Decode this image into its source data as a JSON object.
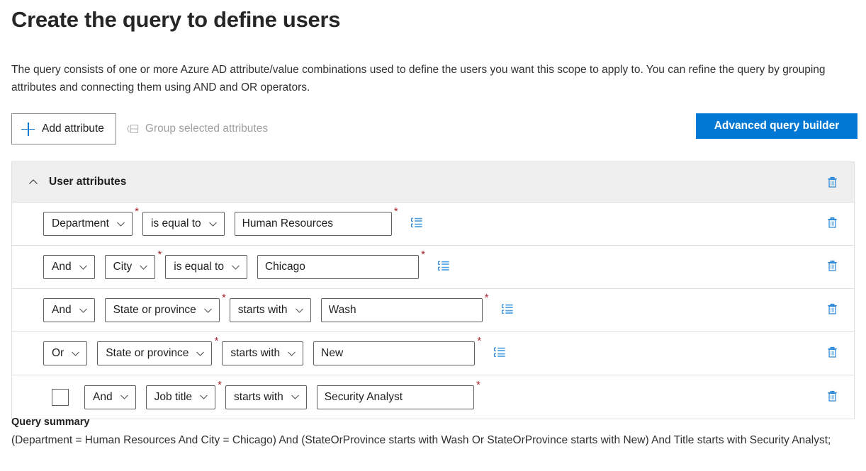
{
  "header": {
    "title": "Create the query to define users",
    "description": "The query consists of one or more Azure AD attribute/value combinations used to define the users you want this scope to apply to. You can refine the query by grouping attributes and connecting them using AND and OR operators."
  },
  "toolbar": {
    "add_attribute_label": "Add attribute",
    "group_selected_label": "Group selected attributes",
    "advanced_query_builder_label": "Advanced query builder",
    "add_icon": "plus-icon",
    "group_icon": "group-attributes-icon"
  },
  "group": {
    "title": "User attributes",
    "collapse_icon": "chevron-up-icon",
    "delete_icon": "trash-icon"
  },
  "rows": [
    {
      "has_checkbox": false,
      "checkbox_checked": false,
      "connector": null,
      "attribute": "Department",
      "operator": "is equal to",
      "value": "Human Resources",
      "value_width": 222,
      "has_list_icon": true,
      "attribute_required": true,
      "value_required": true
    },
    {
      "has_checkbox": false,
      "checkbox_checked": false,
      "connector": "And",
      "attribute": "City",
      "operator": "is equal to",
      "value": "Chicago",
      "value_width": 228,
      "has_list_icon": true,
      "attribute_required": true,
      "value_required": true
    },
    {
      "has_checkbox": false,
      "checkbox_checked": false,
      "connector": "And",
      "attribute": "State or province",
      "operator": "starts with",
      "value": "Wash",
      "value_width": 228,
      "has_list_icon": true,
      "attribute_required": true,
      "value_required": true
    },
    {
      "has_checkbox": false,
      "checkbox_checked": false,
      "connector": "Or",
      "attribute": "State or province",
      "operator": "starts with",
      "value": "New",
      "value_width": 228,
      "has_list_icon": true,
      "attribute_required": true,
      "value_required": true
    },
    {
      "has_checkbox": true,
      "checkbox_checked": false,
      "connector": "And",
      "attribute": "Job title",
      "operator": "starts with",
      "value": "Security Analyst",
      "value_width": 222,
      "has_list_icon": false,
      "attribute_required": true,
      "value_required": true
    }
  ],
  "summary": {
    "title": "Query summary",
    "text": "(Department = Human Resources And City = Chicago) And (StateOrProvince starts with Wash Or StateOrProvince starts with New) And Title starts with Security Analyst;"
  },
  "colors": {
    "accent": "#0078d4",
    "required": "#a4262c",
    "group_header_bg": "#efefef",
    "border": "#e1dfdd",
    "field_border": "#605e5c",
    "disabled_text": "#a19f9d"
  }
}
